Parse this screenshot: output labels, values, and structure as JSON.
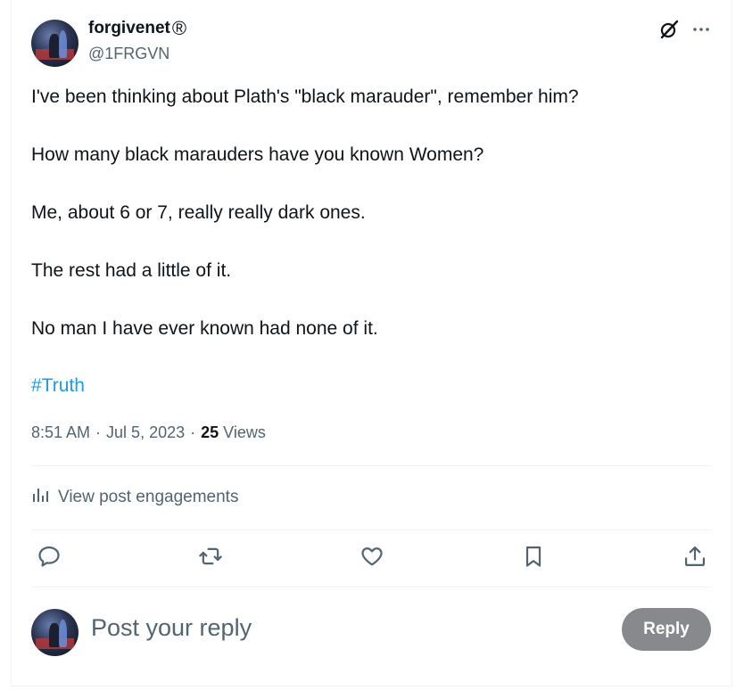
{
  "author": {
    "display_name": "forgivenet",
    "badge": "®",
    "handle": "@1FRGVN",
    "avatar_icon": "avatar-piano-photo"
  },
  "header_icons": {
    "grok": "grok-icon",
    "more": "more-icon"
  },
  "post": {
    "paragraphs": [
      "I've been thinking about Plath's \"black marauder\", remember him?",
      "How many black marauders have you known Women?",
      "Me, about 6 or 7, really really dark ones.",
      "The rest had a little of it.",
      "No man I have ever known had none of it."
    ],
    "hashtag": "#Truth"
  },
  "meta": {
    "time": "8:51 AM",
    "separator": "·",
    "date": "Jul 5, 2023",
    "views_count": "25",
    "views_label": "Views"
  },
  "engagements": {
    "label": "View post engagements",
    "icon": "analytics-icon"
  },
  "actions": [
    {
      "name": "reply",
      "icon": "reply-icon"
    },
    {
      "name": "repost",
      "icon": "repost-icon"
    },
    {
      "name": "like",
      "icon": "like-icon"
    },
    {
      "name": "bookmark",
      "icon": "bookmark-icon"
    },
    {
      "name": "share",
      "icon": "share-icon"
    }
  ],
  "reply_composer": {
    "placeholder": "Post your reply",
    "button_label": "Reply"
  },
  "colors": {
    "text_primary": "#0f1419",
    "text_secondary": "#536471",
    "link": "#1d9bf0",
    "reply_button_bg": "#87898c",
    "divider": "#eff3f4"
  }
}
